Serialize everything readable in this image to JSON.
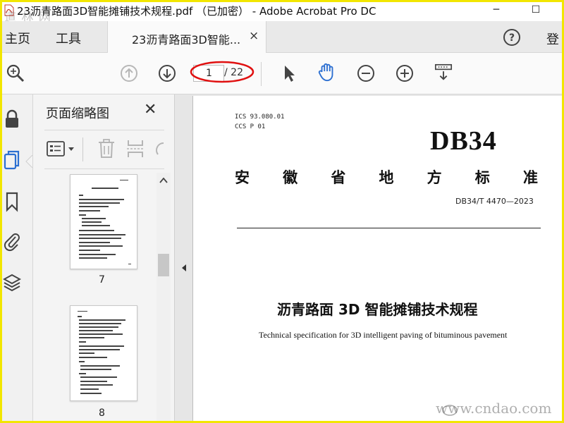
{
  "window": {
    "title": "23沥青路面3D智能摊铺技术规程.pdf （已加密） - Adobe Acrobat Pro DC",
    "minimize": "─",
    "maximize": "☐",
    "watermark_top": "道 林 网"
  },
  "menu": {
    "home": "主页",
    "tools": "工具",
    "doc_tab_label": "23沥青路面3D智能...",
    "doc_tab_close": "×",
    "login": "登"
  },
  "toolbar": {
    "current_page": "1",
    "total_pages": "/ 22",
    "icons": [
      "zoom-search-icon",
      "page-up-icon",
      "page-down-icon",
      "select-arrow-icon",
      "hand-tool-icon",
      "zoom-out-icon",
      "zoom-in-icon",
      "fit-width-icon"
    ]
  },
  "panel": {
    "title": "页面缩略图",
    "close": "✕",
    "thumbnails": [
      {
        "page": "7"
      },
      {
        "page": "8"
      }
    ]
  },
  "document": {
    "ics_line": "ICS  93.080.01",
    "ccs_line": "CCS  P 01",
    "db_label": "DB34",
    "province_chars": [
      "安",
      "徽",
      "省",
      "地",
      "方",
      "标",
      "准"
    ],
    "standard_code": "DB34/T 4470—2023",
    "title_cn": "沥青路面 3D 智能摊铺技术规程",
    "title_en": "Technical specification for 3D intelligent paving of bituminous pavement"
  },
  "watermark_bottom": "www.cndao.com",
  "colors": {
    "accent_blue": "#2c6fd1",
    "highlight_ellipse": "#e01010",
    "frame_yellow": "#f2e600"
  }
}
